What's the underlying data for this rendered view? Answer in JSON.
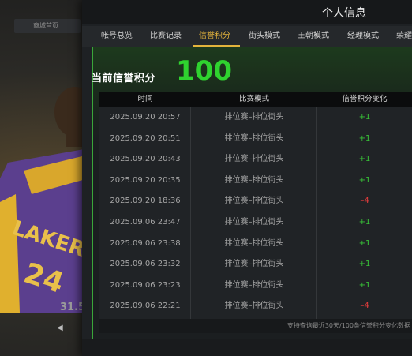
{
  "background": {
    "tab_label": "商城首页",
    "stat_text": "31.5",
    "accent": "#e3b33c"
  },
  "panel": {
    "title": "个人信息"
  },
  "tabs": [
    {
      "label": "帐号总览"
    },
    {
      "label": "比赛记录"
    },
    {
      "label": "信誉积分",
      "active": true
    },
    {
      "label": "街头模式"
    },
    {
      "label": "王朝模式"
    },
    {
      "label": "经理模式"
    },
    {
      "label": "荣耀"
    }
  ],
  "score": {
    "label": "当前信誉积分",
    "value": "100",
    "color": "#2fd32f"
  },
  "table": {
    "headers": {
      "time": "时间",
      "mode": "比赛模式",
      "change": "信誉积分变化"
    },
    "rows": [
      {
        "time": "2025.09.20  20:57",
        "mode": "排位赛–排位街头",
        "change": "+1"
      },
      {
        "time": "2025.09.20  20:51",
        "mode": "排位赛–排位街头",
        "change": "+1"
      },
      {
        "time": "2025.09.20  20:43",
        "mode": "排位赛–排位街头",
        "change": "+1"
      },
      {
        "time": "2025.09.20  20:35",
        "mode": "排位赛–排位街头",
        "change": "+1"
      },
      {
        "time": "2025.09.20  18:36",
        "mode": "排位赛–排位街头",
        "change": "–4"
      },
      {
        "time": "2025.09.06  23:47",
        "mode": "排位赛–排位街头",
        "change": "+1"
      },
      {
        "time": "2025.09.06  23:38",
        "mode": "排位赛–排位街头",
        "change": "+1"
      },
      {
        "time": "2025.09.06  23:32",
        "mode": "排位赛–排位街头",
        "change": "+1"
      },
      {
        "time": "2025.09.06  23:23",
        "mode": "排位赛–排位街头",
        "change": "+1"
      },
      {
        "time": "2025.09.06  22:21",
        "mode": "排位赛–排位街头",
        "change": "–4"
      }
    ],
    "positive_color": "#38c338",
    "negative_color": "#e23c3c"
  },
  "footnote": "支持查询最近30天/100条信誉积分变化数据"
}
